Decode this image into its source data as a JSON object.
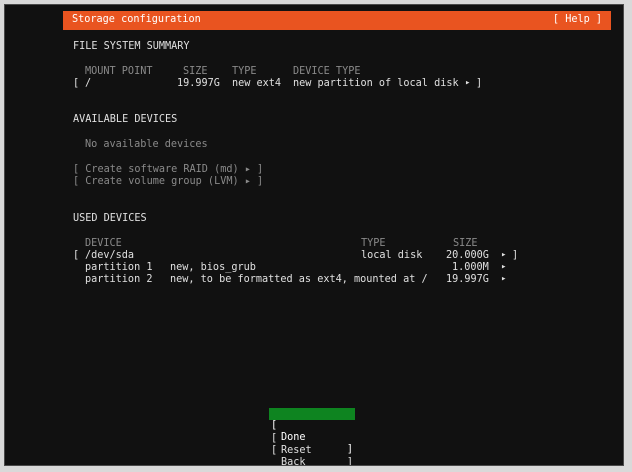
{
  "header": {
    "title": "Storage configuration",
    "help_label": "[ Help ]"
  },
  "fs_summary": {
    "heading": "FILE SYSTEM SUMMARY",
    "columns": [
      "MOUNT POINT",
      "SIZE",
      "TYPE",
      "DEVICE TYPE"
    ],
    "row": {
      "open_bracket": "[",
      "mount": "/",
      "size": "19.997G",
      "type": "new ext4",
      "device_type": "new partition of local disk",
      "arrow": "▸",
      "close_bracket": "]"
    }
  },
  "available": {
    "heading": "AVAILABLE DEVICES",
    "empty_text": "No available devices",
    "raid_label": "[ Create software RAID (md) ▸ ]",
    "lvm_label": "[ Create volume group (LVM) ▸ ]"
  },
  "used": {
    "heading": "USED DEVICES",
    "columns": [
      "DEVICE",
      "TYPE",
      "SIZE"
    ],
    "disk": {
      "open_bracket": "[",
      "device": "/dev/sda",
      "type": "local disk",
      "size": "20.000G",
      "arrow": "▸",
      "close_bracket": "]"
    },
    "partitions": [
      {
        "name": "partition 1",
        "desc": "new, bios_grub",
        "size": "1.000M",
        "arrow": "▸"
      },
      {
        "name": "partition 2",
        "desc": "new, to be formatted as ext4, mounted at /",
        "size": "19.997G",
        "arrow": "▸"
      }
    ]
  },
  "buttons": {
    "bracket_open": "[",
    "bracket_close": "]",
    "done": "Done",
    "reset": "Reset",
    "back": "Back"
  },
  "colors": {
    "header": "#e95420",
    "focus": "#0e8420"
  }
}
